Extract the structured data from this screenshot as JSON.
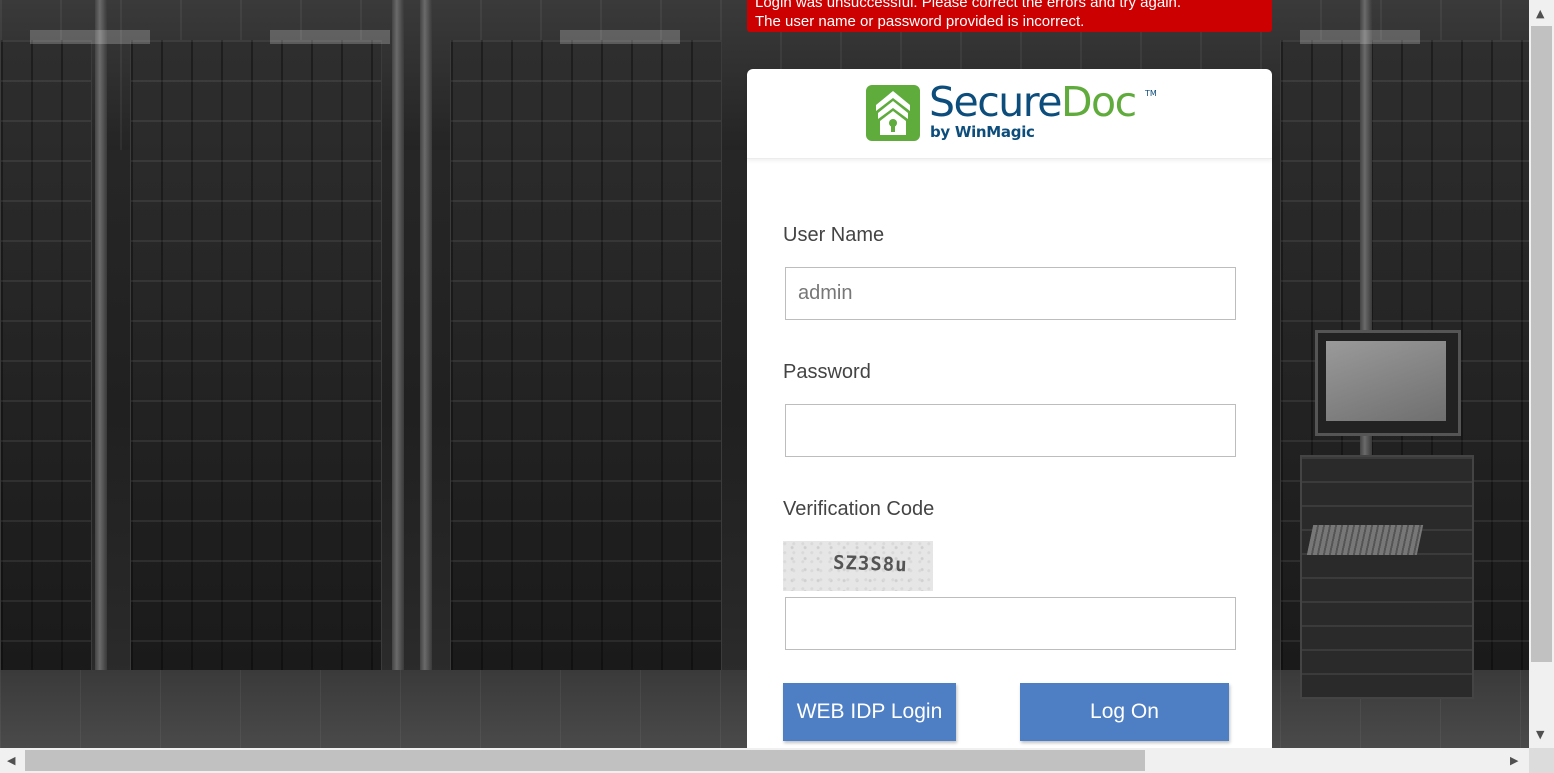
{
  "error": {
    "line1": "Login was unsuccessful. Please correct the errors and try again.",
    "line2": "The user name or password provided is incorrect."
  },
  "logo": {
    "brand_part1": "Secure",
    "brand_part2": "Doc",
    "trademark": "TM",
    "tagline": "by WinMagic",
    "colors": {
      "blue": "#0c4d7c",
      "green": "#5fab3c"
    }
  },
  "form": {
    "username_label": "User Name",
    "username_value": "admin",
    "password_label": "Password",
    "password_value": "",
    "verification_label": "Verification Code",
    "captcha_text": "SZ3S8u",
    "verification_value": ""
  },
  "buttons": {
    "web_idp": "WEB IDP Login",
    "log_on": "Log On",
    "color": "#4e7ec4"
  },
  "error_color": "#cc0000"
}
